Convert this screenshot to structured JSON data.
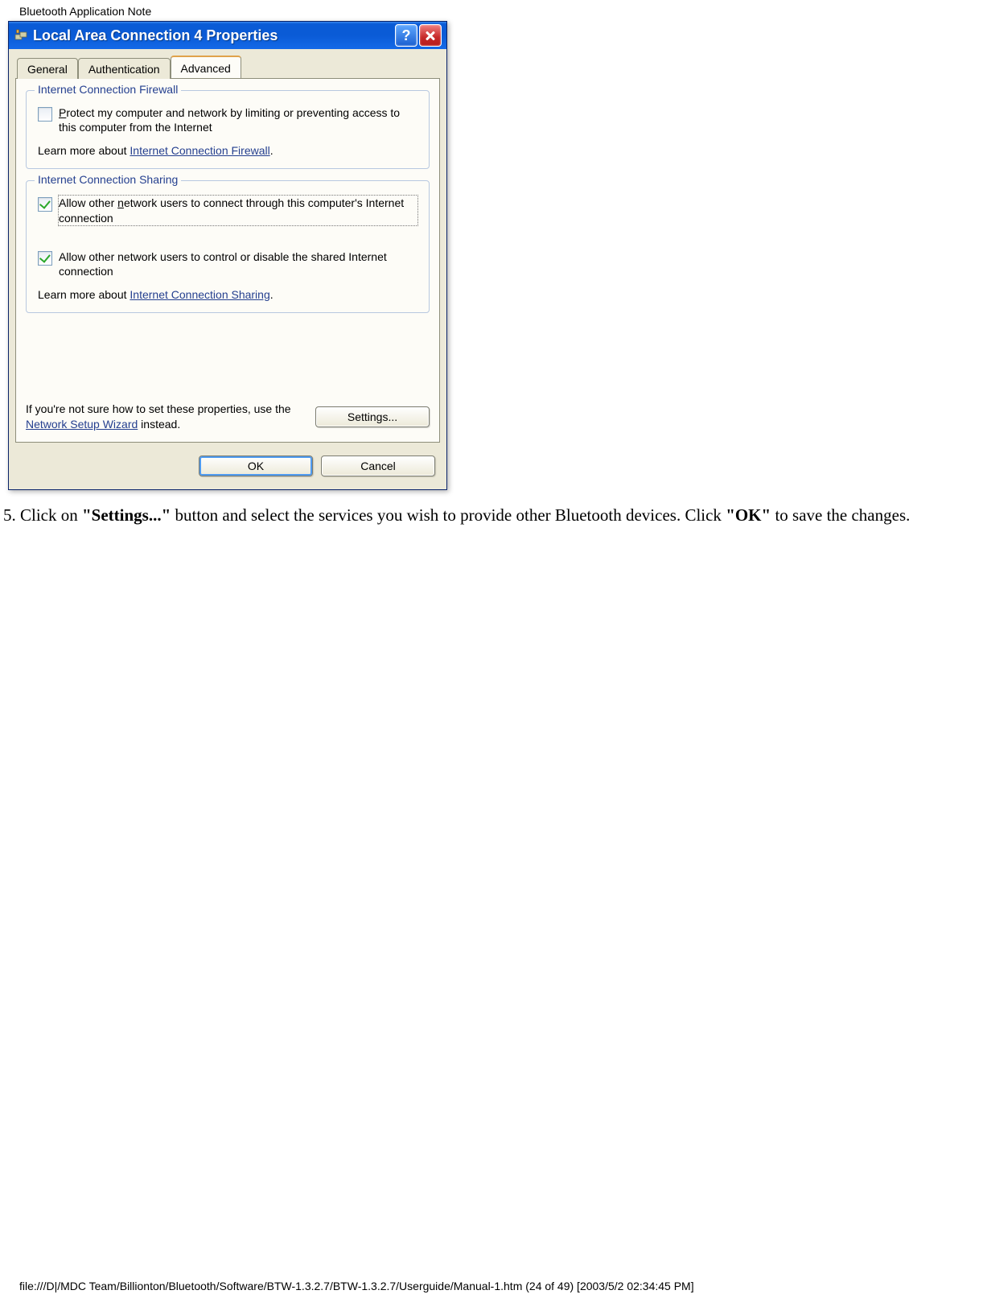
{
  "page": {
    "header": "Bluetooth Application Note",
    "footer": "file:///D|/MDC Team/Billionton/Bluetooth/Software/BTW-1.3.2.7/BTW-1.3.2.7/Userguide/Manual-1.htm (24 of 49) [2003/5/2 02:34:45 PM]"
  },
  "dialog": {
    "title": "Local Area Connection 4 Properties",
    "help_btn": "?",
    "tabs": {
      "general": "General",
      "authentication": "Authentication",
      "advanced": "Advanced"
    },
    "icf": {
      "legend": "Internet Connection Firewall",
      "protect_prefix": "P",
      "protect_text": "rotect my computer and network by limiting or preventing access to this computer from the Internet",
      "learn_prefix": "Learn more about ",
      "learn_link": "Internet Connection Firewall",
      "learn_suffix": "."
    },
    "ics": {
      "legend": "Internet Connection Sharing",
      "allow_connect_prefix": "Allow other ",
      "allow_connect_u": "n",
      "allow_connect_mid": "etwork users to connect through this computer's Internet connection",
      "allow_control_prefix": "Allow other network users to control or disable the shared Internet connection",
      "learn_prefix": "Learn more about ",
      "learn_link": "Internet Connection Sharing",
      "learn_suffix": "."
    },
    "wizard": {
      "pre": "If you're not sure how to set these properties, use the ",
      "link": "Network Setup Wizard",
      "post": " instead."
    },
    "buttons": {
      "settings": "Settings...",
      "ok": "OK",
      "cancel": "Cancel"
    }
  },
  "instruction": {
    "p1a": "5. Click on ",
    "b1": "\"Settings...\"",
    "p1b": " button and select the services you wish to provide other Bluetooth devices. Click ",
    "b2": "\"OK\"",
    "p1c": " to save the changes."
  }
}
